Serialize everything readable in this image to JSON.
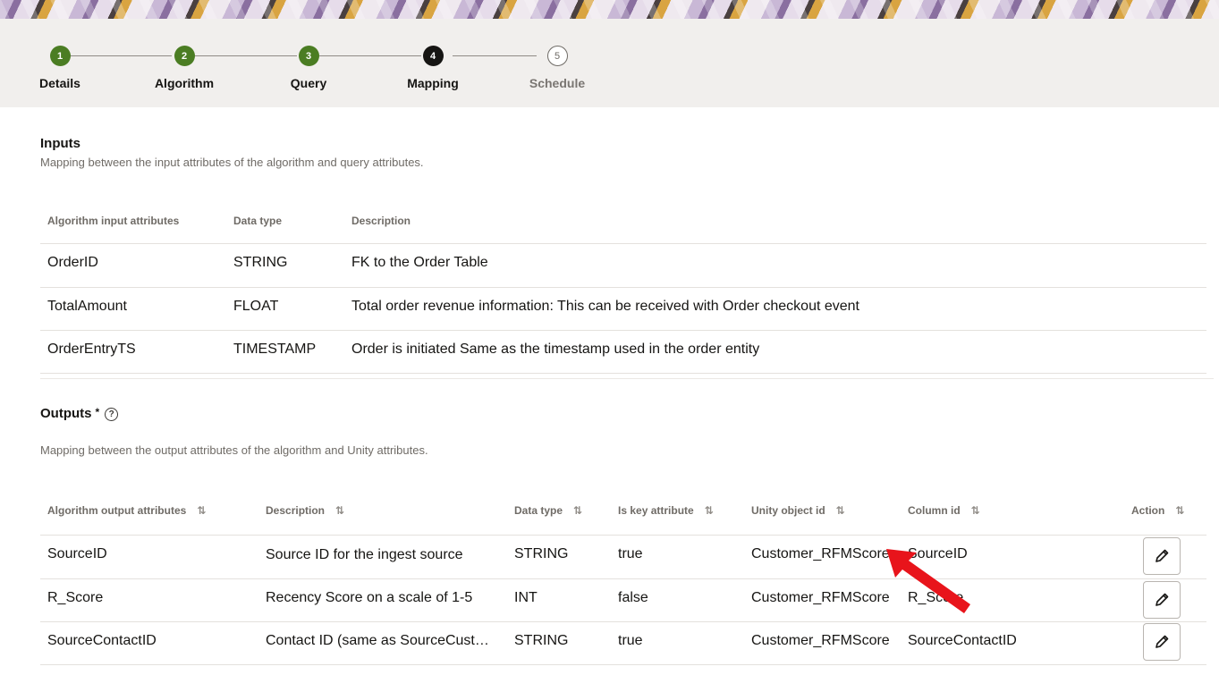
{
  "train": {
    "steps": [
      {
        "number": "1",
        "label": "Details",
        "state": "done"
      },
      {
        "number": "2",
        "label": "Algorithm",
        "state": "done"
      },
      {
        "number": "3",
        "label": "Query",
        "state": "done"
      },
      {
        "number": "4",
        "label": "Mapping",
        "state": "active"
      },
      {
        "number": "5",
        "label": "Schedule",
        "state": "todo"
      }
    ]
  },
  "inputs": {
    "title": "Inputs",
    "description": "Mapping between the input attributes of the algorithm and query attributes.",
    "columns": [
      "Algorithm input attributes",
      "Data type",
      "Description"
    ],
    "rows": [
      [
        "OrderID",
        "STRING",
        "FK to the Order Table"
      ],
      [
        "TotalAmount",
        "FLOAT",
        "Total order revenue information: This can be received with Order checkout event"
      ],
      [
        "OrderEntryTS",
        "TIMESTAMP",
        "Order is initiated Same as the timestamp used in the order entity"
      ]
    ]
  },
  "outputs": {
    "title": "Outputs",
    "required_mark": "*",
    "help_icon": "help-circle-icon",
    "description": "Mapping between the output attributes of the algorithm and Unity attributes.",
    "columns": [
      "Algorithm output attributes",
      "Description",
      "Data type",
      "Is key attribute",
      "Unity object id",
      "Column id",
      "Action"
    ],
    "sort_icon": "⇅",
    "rows": [
      [
        "SourceID",
        "Source ID for the ingest source",
        "STRING",
        "true",
        "Customer_RFMScore",
        "SourceID"
      ],
      [
        "R_Score",
        "Recency Score on a scale of 1-5",
        "INT",
        "false",
        "Customer_RFMScore",
        "R_Score"
      ],
      [
        "SourceContactID",
        "Contact ID (same as SourceCust…",
        "STRING",
        "true",
        "Customer_RFMScore",
        "SourceContactID"
      ]
    ],
    "action_icon": "pencil-icon"
  },
  "colors": {
    "done": "#4b7d23",
    "active": "#161513",
    "annotation_arrow": "#e8141b"
  }
}
